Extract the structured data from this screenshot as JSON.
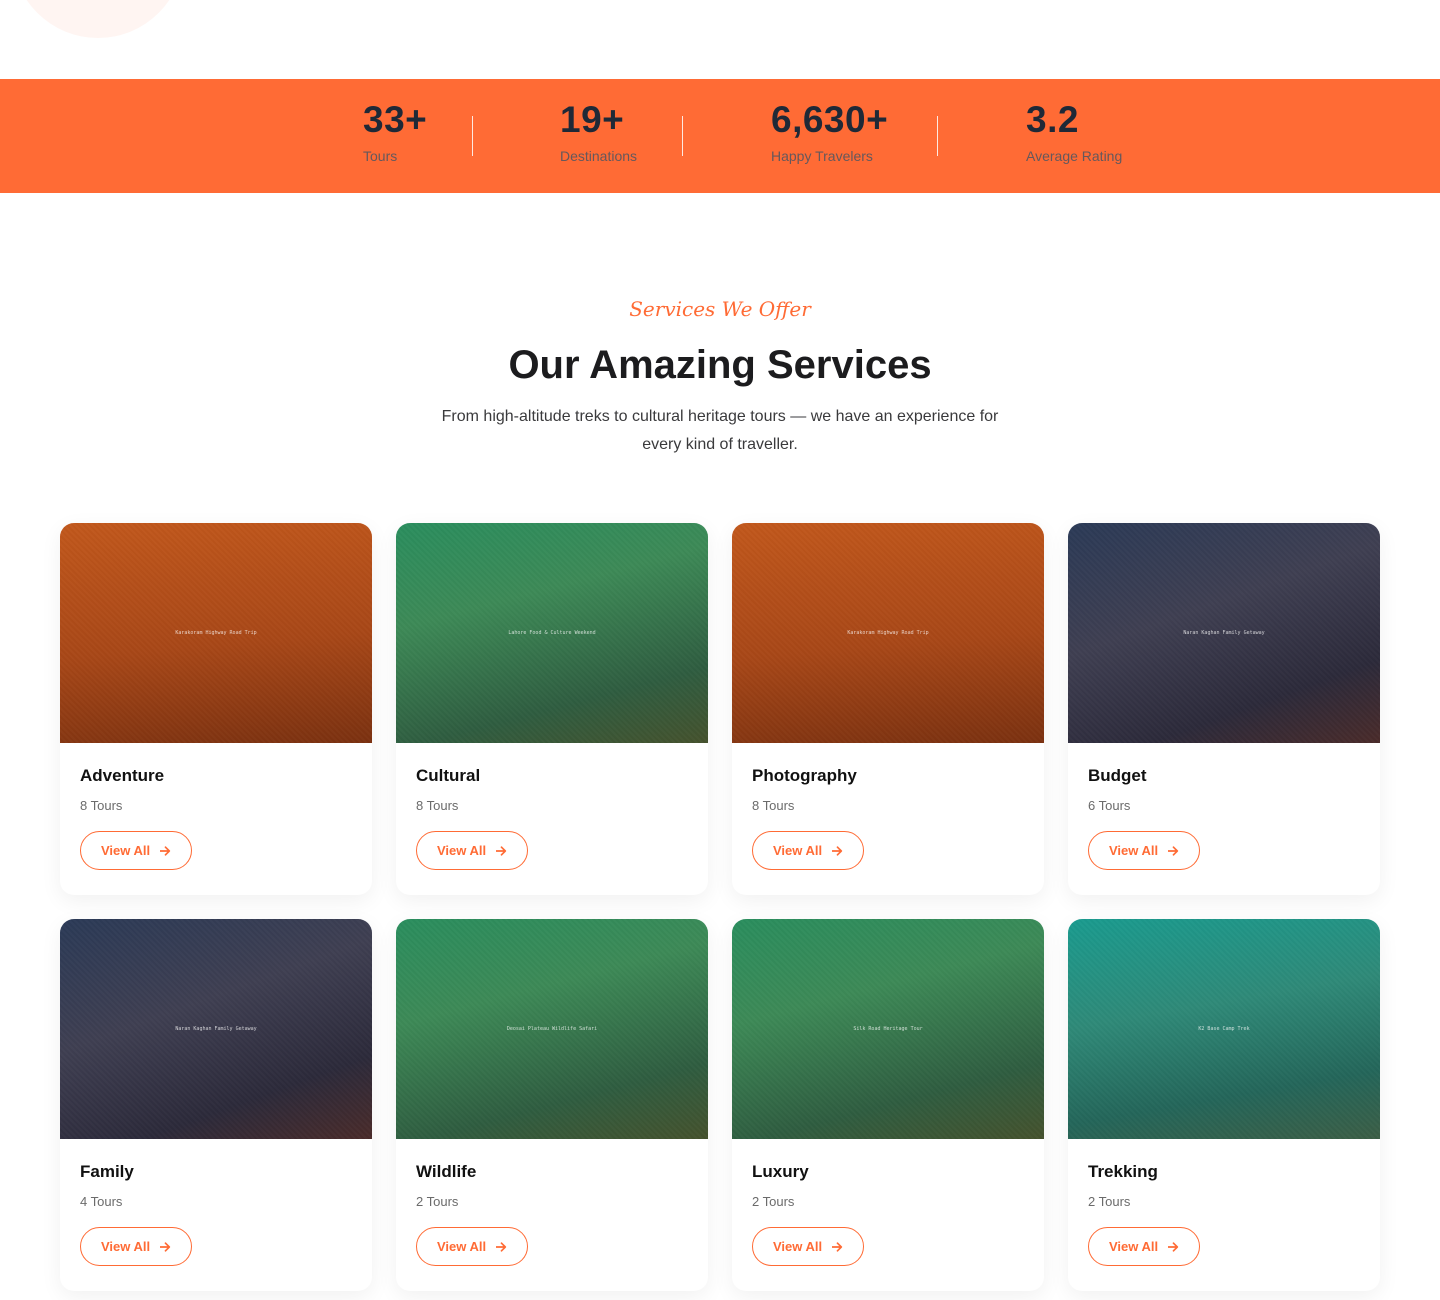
{
  "stats": [
    {
      "value": "33+",
      "label": "Tours"
    },
    {
      "value": "19+",
      "label": "Destinations"
    },
    {
      "value": "6,630+",
      "label": "Happy Travelers"
    },
    {
      "value": "3.2",
      "label": "Average Rating"
    }
  ],
  "services": {
    "kicker": "Services We Offer",
    "title": "Our Amazing Services",
    "description": "From high-altitude treks to cultural heritage tours — we have an experience for every kind of traveller.",
    "cards": [
      {
        "title": "Adventure",
        "count": "8 Tours",
        "button": "View All",
        "image_caption": "Karakoram Highway Road Trip"
      },
      {
        "title": "Cultural",
        "count": "8 Tours",
        "button": "View All",
        "image_caption": "Lahore Food & Culture Weekend"
      },
      {
        "title": "Photography",
        "count": "8 Tours",
        "button": "View All",
        "image_caption": "Karakoram Highway Road Trip"
      },
      {
        "title": "Budget",
        "count": "6 Tours",
        "button": "View All",
        "image_caption": "Naran Kaghan Family Getaway"
      },
      {
        "title": "Family",
        "count": "4 Tours",
        "button": "View All",
        "image_caption": "Naran Kaghan Family Getaway"
      },
      {
        "title": "Wildlife",
        "count": "2 Tours",
        "button": "View All",
        "image_caption": "Deosai Plateau Wildlife Safari"
      },
      {
        "title": "Luxury",
        "count": "2 Tours",
        "button": "View All",
        "image_caption": "Silk Road Heritage Tour"
      },
      {
        "title": "Trekking",
        "count": "2 Tours",
        "button": "View All",
        "image_caption": "K2 Base Camp Trek"
      }
    ]
  },
  "colors": {
    "accent": "#ff6b35",
    "heading": "#1c1c1e"
  }
}
